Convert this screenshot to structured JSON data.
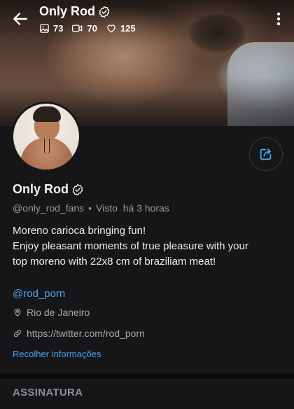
{
  "header": {
    "title": "Only Rod",
    "stats": {
      "photos": "73",
      "videos": "70",
      "likes": "125"
    },
    "icons": [
      "back-arrow-icon",
      "verified-badge-icon",
      "image-icon",
      "video-icon",
      "heart-icon",
      "more-vertical-icon"
    ]
  },
  "profile": {
    "name": "Only Rod",
    "handle": "@only_rod_fans",
    "separator": "•",
    "last_seen": "Visto  há 3 horas",
    "bio_lines": [
      "Moreno carioca bringing fun!",
      "Enjoy pleasant moments of true pleasure with your",
      "top moreno with 22x8 cm of braziliam meat!"
    ],
    "link": "@rod_porn",
    "location": "Rio de Janeiro",
    "website": "https://twitter.com/rod_porn",
    "collapse_label": "Recolher informações"
  },
  "section": {
    "title": "ASSINATURA"
  },
  "colors": {
    "accent": "#4aa3ef",
    "background": "#161618",
    "muted": "#9a9aa0"
  }
}
